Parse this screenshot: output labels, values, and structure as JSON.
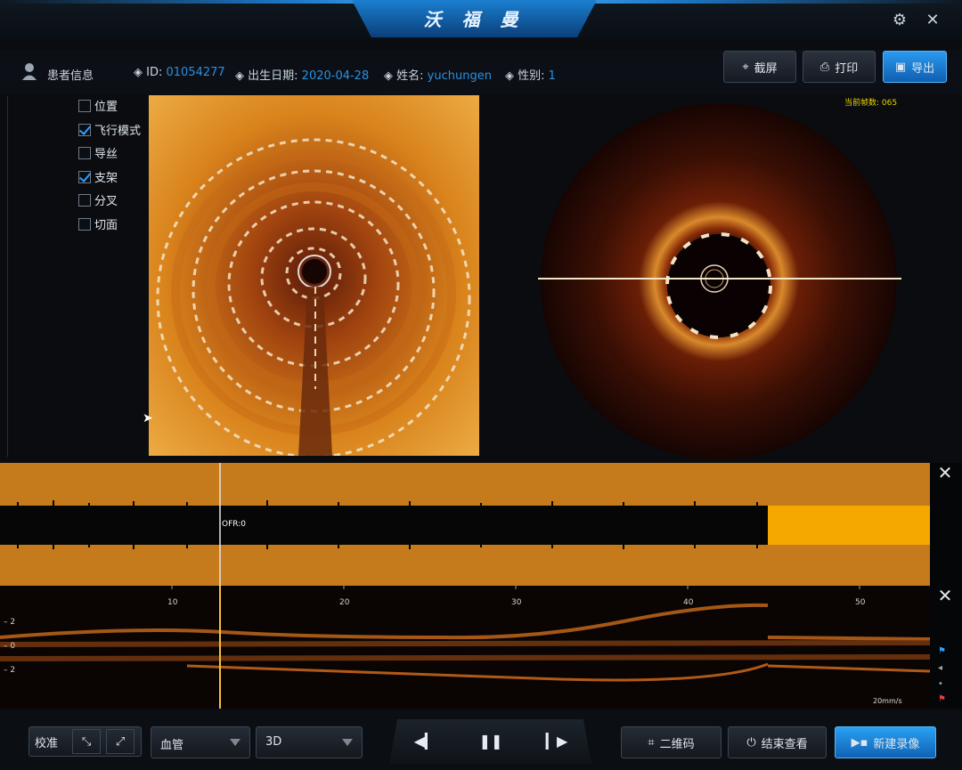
{
  "app": {
    "title": "沃 福 曼"
  },
  "patient": {
    "section_label": "患者信息",
    "id_label": "ID:",
    "id_value": "01054277",
    "dob_label": "出生日期:",
    "dob_value": "2020-04-28",
    "name_label": "姓名:",
    "name_value": "yuchungen",
    "sex_label": "性别:",
    "sex_value": "1"
  },
  "toolbar": {
    "screenshot": "截屏",
    "print": "打印",
    "export": "导出"
  },
  "options": [
    {
      "label": "位置",
      "checked": false
    },
    {
      "label": "飞行模式",
      "checked": true
    },
    {
      "label": "导丝",
      "checked": false
    },
    {
      "label": "支架",
      "checked": true
    },
    {
      "label": "分叉",
      "checked": false
    },
    {
      "label": "切面",
      "checked": false
    }
  ],
  "cross_section": {
    "frame_label": "当前帧数: 065"
  },
  "longitudinal": {
    "ofr_label": "OFR:0"
  },
  "lmode": {
    "x_ticks": [
      "10",
      "20",
      "30",
      "40",
      "50"
    ],
    "y_ticks": [
      "2",
      "0",
      "2"
    ],
    "speed_label": "20mm/s"
  },
  "bottom": {
    "calibrate_label": "校准",
    "vessel_select": "血管",
    "view_select": "3D",
    "qr_label": "二维码",
    "end_label": "结束查看",
    "new_label": "新建录像"
  },
  "colors": {
    "accent": "#1f8fe6",
    "highlight": "#f2a800",
    "track": "#c57a1b"
  }
}
